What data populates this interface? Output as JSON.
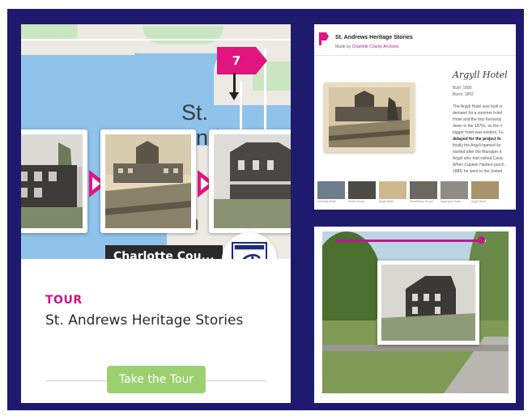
{
  "colors": {
    "frame_bg": "#1f1a6e",
    "accent_magenta": "#c2178a",
    "button_green": "#9bd06f",
    "map_water": "#8fc3ec"
  },
  "left_card": {
    "map": {
      "place_label": "St. Andrews",
      "place_label_partial": "n",
      "marker_count": "7",
      "marker_icon": "map-pin-flag-icon"
    },
    "carousel": {
      "arrow_icon": "play-arrow-icon",
      "photos": [
        "brick-house-photo",
        "argyll-hotel-photo",
        "victorian-house-photo"
      ]
    },
    "chip_label": "Charlotte Cou...",
    "logo_icon": "county-logo-icon",
    "tour_tag": "TOUR",
    "tour_title": "St. Andrews Heritage Stories",
    "button_label": "Take the Tour"
  },
  "right_top_card": {
    "header_title": "St. Andrews Heritage Stories",
    "header_sub_prefix": "Made by",
    "header_sub_link": "Charlotte County Archives",
    "story_title": "Argyll Hotel",
    "meta_lines": [
      "Built: 1880",
      "Burnt: 1892"
    ],
    "body_lines": [
      "The Argyll Hotel was built in",
      "demand for a summer hotel",
      "Hotel and the first Kennedy",
      "down in the 1870s, so the n",
      "bigger hotel was evident. Fu",
      "delayed for the project fo",
      "finally the Argyll opened its",
      "started after the Manager d",
      "Argyll who had visited Cana",
      "When Captain Harbert purch",
      "1888, he went to the United"
    ],
    "bold_body_line_index": 5,
    "thumbnails": [
      {
        "caption": "Kennedy Hotel"
      },
      {
        "caption": "Smith House"
      },
      {
        "caption": "Argyll Hotel"
      },
      {
        "caption": "Pendlebury House"
      },
      {
        "caption": "Algonquin Hotel"
      },
      {
        "caption": "Argyll Hotel"
      }
    ]
  },
  "right_bottom_card": {
    "slider_progress_fraction": 0.97,
    "inset_photo": "brick-house-photo",
    "slider_handle_icon": "slider-handle-icon"
  }
}
